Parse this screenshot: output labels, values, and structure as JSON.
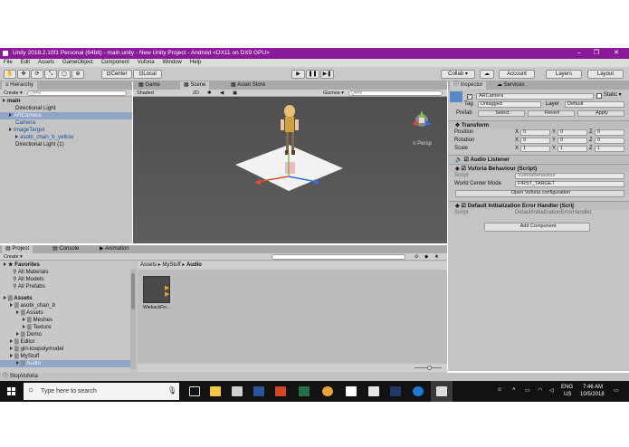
{
  "window": {
    "title": "Unity 2018.2.10f1 Personal (64bit) - main.unity - New Unity Project - Android <DX11 on DX9 GPU>",
    "minimize": "–",
    "maximize": "❐",
    "close": "✕"
  },
  "menu": [
    "File",
    "Edit",
    "Assets",
    "GameObject",
    "Component",
    "Vuforia",
    "Window",
    "Help"
  ],
  "toolbar": {
    "pivot": "Center",
    "space": "Local",
    "collab": "Collab ▾",
    "account": "Account",
    "layers": "Layers",
    "layout": "Layout"
  },
  "hierarchy": {
    "tab": "Hierarchy",
    "create": "Create ▾",
    "search_placeholder": "Q▾All",
    "items": [
      {
        "label": "main",
        "indent": 0
      },
      {
        "label": "Directional Light",
        "indent": 2
      },
      {
        "label": "ARCamera",
        "indent": 1,
        "selected": true
      },
      {
        "label": "Camera",
        "indent": 2
      },
      {
        "label": "ImageTarget",
        "indent": 1
      },
      {
        "label": "asobi_chan_b_yellow",
        "indent": 2
      },
      {
        "label": "Directional Light (1)",
        "indent": 2
      }
    ]
  },
  "scene": {
    "tabs": [
      "Game",
      "Scene",
      "Asset Store"
    ],
    "shaded": "Shaded",
    "mode_2d": "2D",
    "gizmos": "Gizmos ▾",
    "search_placeholder": "Q▾All",
    "persp": "≡ Persp"
  },
  "inspector": {
    "tabs": [
      "Inspector",
      "Services"
    ],
    "object_name": "ARCamera",
    "static": "Static ▾",
    "tag_label": "Tag",
    "tag_value": "Untagged",
    "layer_label": "Layer",
    "layer_value": "Default",
    "prefab_label": "Prefab",
    "prefab_select": "Select",
    "prefab_revert": "Revert",
    "prefab_apply": "Apply",
    "transform": {
      "title": "Transform",
      "rows": [
        {
          "label": "Position",
          "x": "0",
          "y": "0",
          "z": "0"
        },
        {
          "label": "Rotation",
          "x": "0",
          "y": "0",
          "z": "0"
        },
        {
          "label": "Scale",
          "x": "1",
          "y": "1",
          "z": "1"
        }
      ],
      "x_label": "X",
      "y_label": "Y",
      "z_label": "Z"
    },
    "audio_listener": "Audio Listener",
    "vuforia_behaviour": {
      "title": "Vuforia Behaviour (Script)",
      "script_label": "Script",
      "script_value": "VuforiaBehaviour",
      "world_center_label": "World Center Mode",
      "world_center_value": "FIRST_TARGET",
      "open_config": "Open Vuforia configuration"
    },
    "error_handler": {
      "title": "Default Initialization Error Handler (Scrij",
      "script_label": "Script",
      "script_value": "DefaultInitializationErrorHandler"
    },
    "add_component": "Add Component"
  },
  "project": {
    "tabs": [
      "Project",
      "Console",
      "Animation"
    ],
    "create": "Create ▾",
    "favorites": "Favorites",
    "fav_items": [
      "All Materials",
      "All Models",
      "All Prefabs"
    ],
    "assets_root": "Assets",
    "tree": [
      {
        "label": "asobi_chan_b",
        "indent": 1
      },
      {
        "label": "Assets",
        "indent": 2
      },
      {
        "label": "Meshes",
        "indent": 3
      },
      {
        "label": "Texture",
        "indent": 3
      },
      {
        "label": "Demo",
        "indent": 2
      },
      {
        "label": "Editor",
        "indent": 1
      },
      {
        "label": "girl-lowpolymodel",
        "indent": 1
      },
      {
        "label": "MyStuff",
        "indent": 1
      },
      {
        "label": "Audio",
        "indent": 2,
        "selected": true
      }
    ],
    "breadcrumb": [
      "Assets",
      "MyStuff",
      "Audio"
    ],
    "file_name": "WiebackFin..."
  },
  "status": {
    "text": "StopVuforia"
  },
  "taskbar": {
    "search_placeholder": "Type here to search",
    "lang": "ENG",
    "region": "US",
    "time": "7:46 AM",
    "date": "10/5/2018"
  },
  "colors": {
    "title_bar": "#8a1a9a",
    "scene_bg": "#555555",
    "plane": "#f2f2f2",
    "selection": "#8fa6c8",
    "taskbar": "#121212"
  }
}
